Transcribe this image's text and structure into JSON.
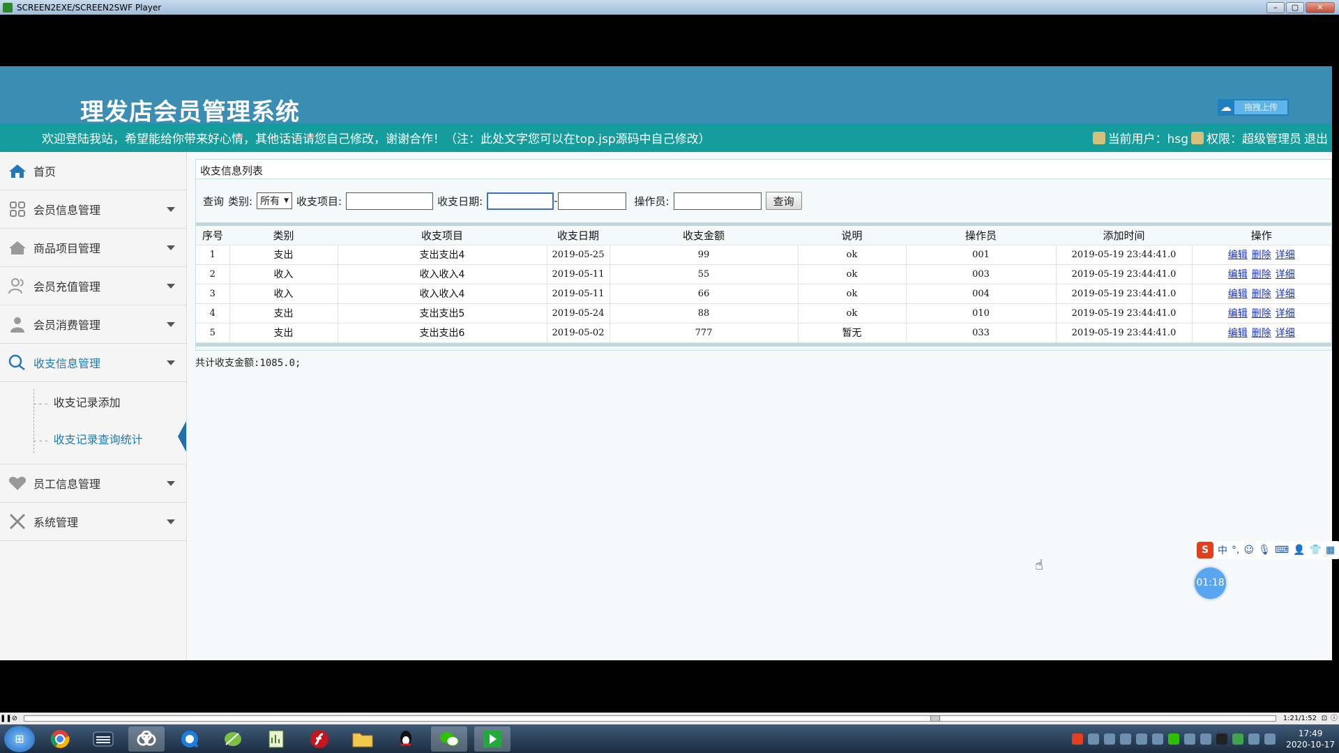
{
  "window": {
    "title": "SCREEN2EXE/SCREEN2SWF Player"
  },
  "header": {
    "system_title": "理发店会员管理系统",
    "upload_label": "拖拽上传",
    "welcome_text": "欢迎登陆我站，希望能给你带来好心情，其他话语请您自己修改，谢谢合作！（注：此处文字您可以在top.jsp源码中自己修改）",
    "current_user": "当前用户：hsg",
    "permission": "权限：超级管理员",
    "logout": "退出"
  },
  "sidebar": {
    "items": [
      {
        "label": "首页",
        "icon": "home-icon"
      },
      {
        "label": "会员信息管理",
        "icon": "grid-icon"
      },
      {
        "label": "商品项目管理",
        "icon": "house-icon"
      },
      {
        "label": "会员充值管理",
        "icon": "users-icon"
      },
      {
        "label": "会员消费管理",
        "icon": "person-icon"
      },
      {
        "label": "收支信息管理",
        "icon": "chat-icon"
      },
      {
        "label": "员工信息管理",
        "icon": "heart-icon"
      },
      {
        "label": "系统管理",
        "icon": "tools-icon"
      }
    ],
    "sub_items": [
      {
        "label": "收支记录添加"
      },
      {
        "label": "收支记录查询统计"
      }
    ]
  },
  "panel": {
    "title": "收支信息列表",
    "query": {
      "query_label": "查询",
      "type_label": "类别:",
      "type_value": "所有",
      "item_label": "收支项目:",
      "date_label": "收支日期:",
      "operator_label": "操作员:",
      "search_button": "查询"
    },
    "columns": [
      "序号",
      "类别",
      "收支项目",
      "收支日期",
      "收支金额",
      "说明",
      "操作员",
      "添加时间",
      "操作"
    ],
    "rows": [
      {
        "no": "1",
        "type": "支出",
        "item": "支出支出4",
        "date": "2019-05-25",
        "amount": "99",
        "note": "ok",
        "operator": "001",
        "added": "2019-05-19 23:44:41.0"
      },
      {
        "no": "2",
        "type": "收入",
        "item": "收入收入4",
        "date": "2019-05-11",
        "amount": "55",
        "note": "ok",
        "operator": "003",
        "added": "2019-05-19 23:44:41.0"
      },
      {
        "no": "3",
        "type": "收入",
        "item": "收入收入4",
        "date": "2019-05-11",
        "amount": "66",
        "note": "ok",
        "operator": "004",
        "added": "2019-05-19 23:44:41.0"
      },
      {
        "no": "4",
        "type": "支出",
        "item": "支出支出5",
        "date": "2019-05-24",
        "amount": "88",
        "note": "ok",
        "operator": "010",
        "added": "2019-05-19 23:44:41.0"
      },
      {
        "no": "5",
        "type": "支出",
        "item": "支出支出6",
        "date": "2019-05-02",
        "amount": "777",
        "note": "暂无",
        "operator": "033",
        "added": "2019-05-19 23:44:41.0"
      }
    ],
    "ops": {
      "edit": "编辑",
      "delete": "删除",
      "detail": "详细"
    },
    "total": "共计收支金额:1085.0;"
  },
  "widgets": {
    "ime_label": "中",
    "timer": "01:18"
  },
  "player": {
    "time": "1:21/1:52",
    "progress": 0.73
  },
  "taskbar": {
    "clock_time": "17:49",
    "clock_date": "2020-10-17"
  }
}
